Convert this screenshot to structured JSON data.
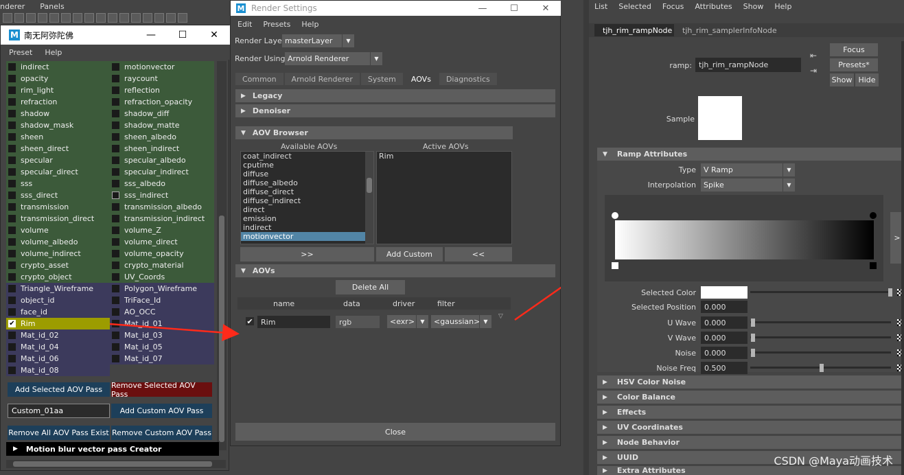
{
  "topbar": {
    "menu": [
      "nderer",
      "Panels"
    ]
  },
  "left_window": {
    "title": "南无阿弥陀佛",
    "logo": "M",
    "controls": {
      "minimize": "—",
      "maximize": "☐",
      "close": "✕"
    },
    "menu": [
      "Preset",
      "Help"
    ],
    "col1": [
      {
        "label": "indirect",
        "checked": false
      },
      {
        "label": "opacity",
        "checked": false
      },
      {
        "label": "rim_light",
        "checked": false
      },
      {
        "label": "refraction",
        "checked": false
      },
      {
        "label": "shadow",
        "checked": false
      },
      {
        "label": "shadow_mask",
        "checked": false
      },
      {
        "label": "sheen",
        "checked": false
      },
      {
        "label": "sheen_direct",
        "checked": false
      },
      {
        "label": "specular",
        "checked": false
      },
      {
        "label": "specular_direct",
        "checked": false
      },
      {
        "label": "sss",
        "checked": false
      },
      {
        "label": "sss_direct",
        "checked": false
      },
      {
        "label": "transmission",
        "checked": false
      },
      {
        "label": "transmission_direct",
        "checked": false
      },
      {
        "label": "volume",
        "checked": false
      },
      {
        "label": "volume_albedo",
        "checked": false
      },
      {
        "label": "volume_indirect",
        "checked": false
      },
      {
        "label": "crypto_asset",
        "checked": false
      },
      {
        "label": "crypto_object",
        "checked": false
      },
      {
        "label": "Triangle_Wireframe",
        "checked": false
      },
      {
        "label": "object_id",
        "checked": false
      },
      {
        "label": "face_id",
        "checked": false
      },
      {
        "label": "Rim",
        "checked": true
      },
      {
        "label": "Mat_id_02",
        "checked": false
      },
      {
        "label": "Mat_id_04",
        "checked": false
      },
      {
        "label": "Mat_id_06",
        "checked": false
      },
      {
        "label": "Mat_id_08",
        "checked": false
      }
    ],
    "col2": [
      {
        "label": "motionvector",
        "checked": false
      },
      {
        "label": "raycount",
        "checked": false
      },
      {
        "label": "reflection",
        "checked": false
      },
      {
        "label": "refraction_opacity",
        "checked": false
      },
      {
        "label": "shadow_diff",
        "checked": false
      },
      {
        "label": "shadow_matte",
        "checked": false
      },
      {
        "label": "sheen_albedo",
        "checked": false
      },
      {
        "label": "sheen_indirect",
        "checked": false
      },
      {
        "label": "specular_albedo",
        "checked": false
      },
      {
        "label": "specular_indirect",
        "checked": false
      },
      {
        "label": "sss_albedo",
        "checked": false
      },
      {
        "label": "sss_indirect",
        "checked": false,
        "hollow": true
      },
      {
        "label": "transmission_albedo",
        "checked": false
      },
      {
        "label": "transmission_indirect",
        "checked": false
      },
      {
        "label": "volume_Z",
        "checked": false
      },
      {
        "label": "volume_direct",
        "checked": false
      },
      {
        "label": "volume_opacity",
        "checked": false
      },
      {
        "label": "crypto_material",
        "checked": false
      },
      {
        "label": "UV_Coords",
        "checked": false
      },
      {
        "label": "Polygon_Wireframe",
        "checked": false
      },
      {
        "label": "TriFace_Id",
        "checked": false
      },
      {
        "label": "AO_OCC",
        "checked": false
      },
      {
        "label": "Mat_id_01",
        "checked": false
      },
      {
        "label": "Mat_id_03",
        "checked": false
      },
      {
        "label": "Mat_id_05",
        "checked": false
      },
      {
        "label": "Mat_id_07",
        "checked": false
      }
    ],
    "buttons": {
      "add_selected": "Add Selected AOV Pass",
      "remove_selected": "Remove Selected AOV Pass",
      "custom_value": "Custom_01aa",
      "add_custom": "Add Custom AOV Pass",
      "remove_all": "Remove All AOV Pass Exist",
      "remove_custom": "Remove Custom AOV Pass"
    },
    "motion_blur": "Motion blur vector pass Creator",
    "colors": {
      "green": "#3c5a3a",
      "purple": "#3c3a5c",
      "highlight": "#9c9c00",
      "blue_btn": "#1d3f5a",
      "red_btn": "#6b0f0f"
    }
  },
  "render_settings": {
    "title": "Render Settings",
    "logo": "M",
    "controls": {
      "minimize": "—",
      "maximize": "☐",
      "close": "✕"
    },
    "menu": [
      "Edit",
      "Presets",
      "Help"
    ],
    "render_layer_label": "Render Layer",
    "render_layer_value": "masterLayer",
    "render_using_label": "Render Using",
    "render_using_value": "Arnold Renderer",
    "tabs": [
      "Common",
      "Arnold Renderer",
      "System",
      "AOVs",
      "Diagnostics"
    ],
    "active_tab": "AOVs",
    "sections": {
      "legacy": "Legacy",
      "denoiser": "Denoiser",
      "aov_browser": "AOV Browser",
      "aovs": "AOVs"
    },
    "available_label": "Available AOVs",
    "active_label": "Active AOVs",
    "available": [
      "coat_indirect",
      "cputime",
      "diffuse",
      "diffuse_albedo",
      "diffuse_direct",
      "diffuse_indirect",
      "direct",
      "emission",
      "indirect",
      "motionvector"
    ],
    "selected_available": "motionvector",
    "active": [
      "Rim"
    ],
    "btn_add": ">>",
    "btn_custom": "Add Custom",
    "btn_remove": "<<",
    "delete_all": "Delete All",
    "table_headers": [
      "name",
      "data",
      "driver",
      "filter"
    ],
    "aov_row": {
      "name": "Rim",
      "data": "rgb",
      "driver": "<exr>",
      "filter": "<gaussian>"
    },
    "close": "Close"
  },
  "attribute_editor": {
    "menu": [
      "List",
      "Selected",
      "Focus",
      "Attributes",
      "Show",
      "Help"
    ],
    "tabs": [
      "tjh_rim_rampNode",
      "tjh_rim_samplerInfoNode"
    ],
    "ramp_label": "ramp:",
    "ramp_value": "tjh_rim_rampNode",
    "focus": "Focus",
    "presets": "Presets*",
    "show": "Show",
    "hide": "Hide",
    "sample_label": "Sample",
    "ramp_section": "Ramp Attributes",
    "type_label": "Type",
    "type_value": "V Ramp",
    "interp_label": "Interpolation",
    "interp_value": "Spike",
    "expand_btn": ">",
    "fields": [
      {
        "label": "Selected Color",
        "value": ""
      },
      {
        "label": "Selected Position",
        "value": "0.000"
      },
      {
        "label": "U Wave",
        "value": "0.000",
        "slider": 0.0
      },
      {
        "label": "V Wave",
        "value": "0.000",
        "slider": 0.0
      },
      {
        "label": "Noise",
        "value": "0.000",
        "slider": 0.0
      },
      {
        "label": "Noise Freq",
        "value": "0.500",
        "slider": 0.5
      }
    ],
    "sections": [
      "HSV Color Noise",
      "Color Balance",
      "Effects",
      "UV Coordinates",
      "Node Behavior",
      "UUID",
      "Extra Attributes"
    ]
  },
  "watermark": "CSDN @Maya动画技术"
}
